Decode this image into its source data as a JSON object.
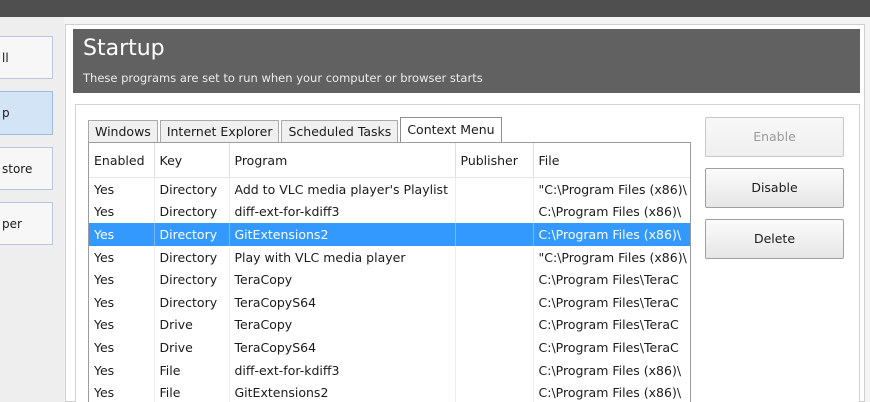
{
  "sidebar": {
    "items": [
      {
        "label": "ll",
        "active": false
      },
      {
        "label": "p",
        "active": true
      },
      {
        "label": "store",
        "active": false
      },
      {
        "label": "per",
        "active": false
      }
    ]
  },
  "header": {
    "title": "Startup",
    "subtitle": "These programs are set to run when your computer or browser starts"
  },
  "tabs": [
    {
      "label": "Windows",
      "active": false
    },
    {
      "label": "Internet Explorer",
      "active": false
    },
    {
      "label": "Scheduled Tasks",
      "active": false
    },
    {
      "label": "Context Menu",
      "active": true
    }
  ],
  "table": {
    "columns": [
      "Enabled",
      "Key",
      "Program",
      "Publisher",
      "File"
    ],
    "rows": [
      {
        "enabled": "Yes",
        "key": "Directory",
        "program": "Add to VLC media player's Playlist",
        "publisher": "",
        "file": "\"C:\\Program Files (x86)\\",
        "selected": false
      },
      {
        "enabled": "Yes",
        "key": "Directory",
        "program": "diff-ext-for-kdiff3",
        "publisher": "",
        "file": "C:\\Program Files (x86)\\",
        "selected": false
      },
      {
        "enabled": "Yes",
        "key": "Directory",
        "program": "GitExtensions2",
        "publisher": "",
        "file": "C:\\Program Files (x86)\\",
        "selected": true
      },
      {
        "enabled": "Yes",
        "key": "Directory",
        "program": "Play with VLC media player",
        "publisher": "",
        "file": "\"C:\\Program Files (x86)\\",
        "selected": false
      },
      {
        "enabled": "Yes",
        "key": "Directory",
        "program": "TeraCopy",
        "publisher": "",
        "file": "C:\\Program Files\\TeraC",
        "selected": false
      },
      {
        "enabled": "Yes",
        "key": "Directory",
        "program": "TeraCopyS64",
        "publisher": "",
        "file": "C:\\Program Files\\TeraC",
        "selected": false
      },
      {
        "enabled": "Yes",
        "key": "Drive",
        "program": "TeraCopy",
        "publisher": "",
        "file": "C:\\Program Files\\TeraC",
        "selected": false
      },
      {
        "enabled": "Yes",
        "key": "Drive",
        "program": "TeraCopyS64",
        "publisher": "",
        "file": "C:\\Program Files\\TeraC",
        "selected": false
      },
      {
        "enabled": "Yes",
        "key": "File",
        "program": "diff-ext-for-kdiff3",
        "publisher": "",
        "file": "C:\\Program Files (x86)\\",
        "selected": false
      },
      {
        "enabled": "Yes",
        "key": "File",
        "program": "GitExtensions2",
        "publisher": "",
        "file": "C:\\Program Files (x86)\\",
        "selected": false
      }
    ]
  },
  "buttons": {
    "enable": {
      "label": "Enable",
      "disabled": true
    },
    "disable": {
      "label": "Disable",
      "disabled": false
    },
    "delete": {
      "label": "Delete",
      "disabled": false
    }
  },
  "colors": {
    "header_band": "#616161",
    "selection": "#3399ff",
    "sidebar_active": "#d2e4f6"
  }
}
